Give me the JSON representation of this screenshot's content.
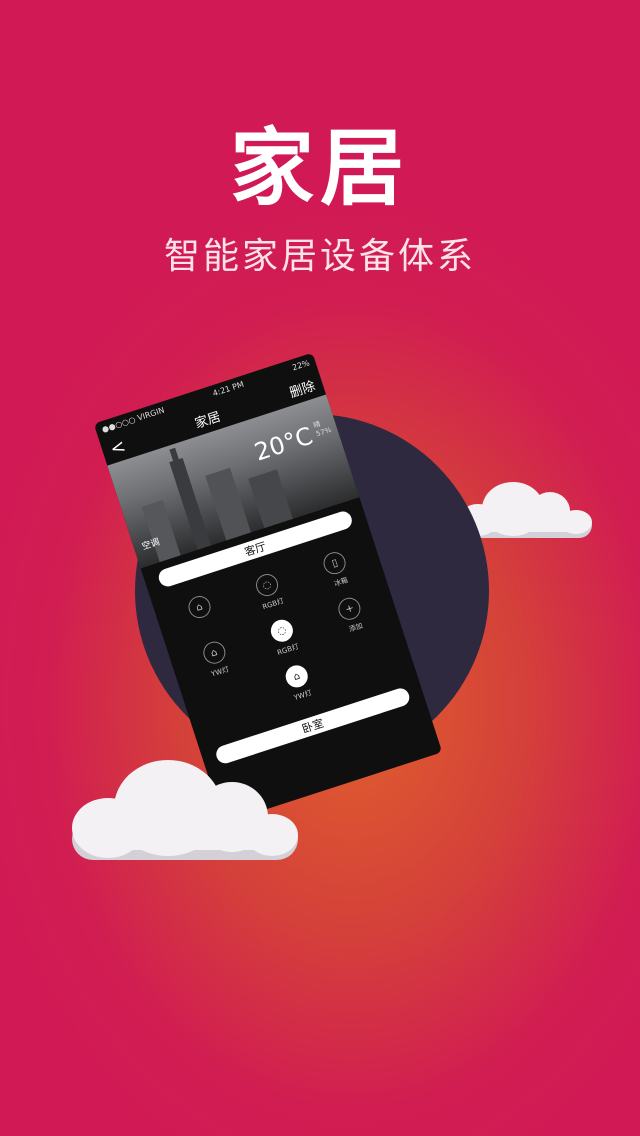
{
  "hero": {
    "title": "家居",
    "subtitle": "智能家居设备体系"
  },
  "phone": {
    "status": {
      "carrier": "●●○○○ VIRGIN",
      "time": "4:21 PM",
      "battery": "22%"
    },
    "navbar": {
      "back": "<",
      "title": "家居",
      "action": "删除"
    },
    "weather": {
      "temperature": "20°C",
      "detail_1": "晴",
      "detail_2": "57%"
    },
    "chip": "空调",
    "rooms": [
      {
        "name": "客厅",
        "devices": [
          {
            "label": "",
            "icon": "lamp-icon",
            "on": false
          },
          {
            "label": "RGB灯",
            "icon": "bulb-icon",
            "on": false
          },
          {
            "label": "冰箱",
            "icon": "fridge-icon",
            "on": false
          },
          {
            "label": "YW灯",
            "icon": "lamp-icon",
            "on": false
          },
          {
            "label": "RGB灯",
            "icon": "bulb-icon",
            "on": true
          },
          {
            "label": "添加",
            "icon": "plus-icon",
            "on": false
          },
          {
            "label": "YW灯",
            "icon": "lamp-icon",
            "on": true
          }
        ]
      },
      {
        "name": "卧室",
        "devices": []
      }
    ]
  },
  "colors": {
    "background": "#d11a55",
    "accent": "#e0602c",
    "circle": "#2f2940",
    "cloud": "#f4f1f4"
  }
}
